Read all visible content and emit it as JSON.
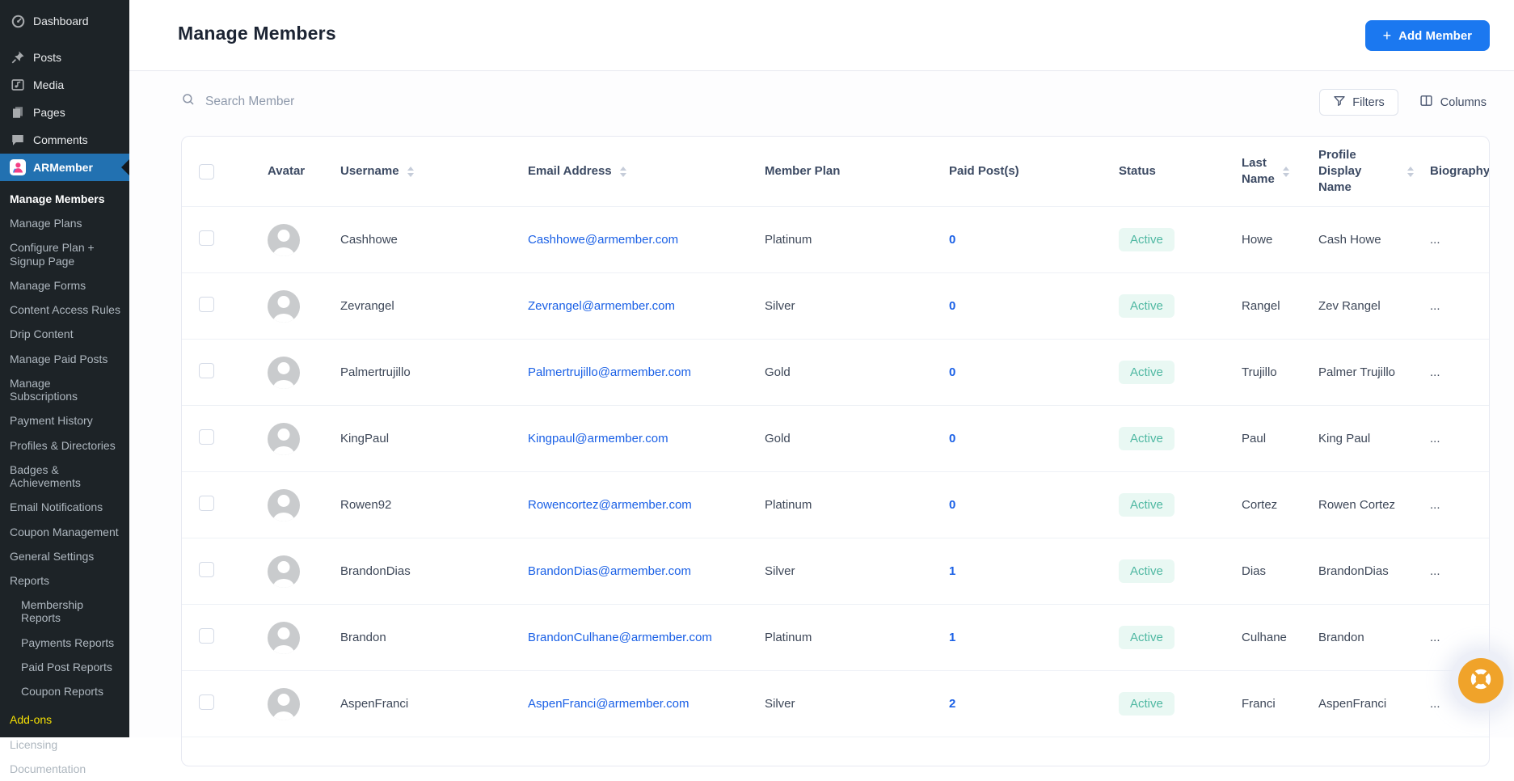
{
  "sidebar": {
    "top": [
      {
        "label": "Dashboard"
      },
      {
        "label": "Posts"
      },
      {
        "label": "Media"
      },
      {
        "label": "Pages"
      },
      {
        "label": "Comments"
      },
      {
        "label": "ARMember"
      }
    ],
    "submenu": [
      {
        "label": "Manage Members",
        "mods": "active"
      },
      {
        "label": "Manage Plans"
      },
      {
        "label": "Configure Plan +\nSignup Page"
      },
      {
        "label": "Manage Forms"
      },
      {
        "label": "Content Access Rules"
      },
      {
        "label": "Drip Content"
      },
      {
        "label": "Manage Paid Posts"
      },
      {
        "label": "Manage Subscriptions"
      },
      {
        "label": "Payment History"
      },
      {
        "label": "Profiles & Directories"
      },
      {
        "label": "Badges &\nAchievements"
      },
      {
        "label": "Email Notifications"
      },
      {
        "label": "Coupon Management"
      },
      {
        "label": "General Settings"
      },
      {
        "label": "Reports"
      },
      {
        "label": "Membership Reports",
        "mods": "indent"
      },
      {
        "label": "Payments Reports",
        "mods": "indent"
      },
      {
        "label": "Paid Post Reports",
        "mods": "indent"
      },
      {
        "label": "Coupon Reports",
        "mods": "indent"
      },
      {
        "label": "Add-ons",
        "mods": "yellow gap"
      },
      {
        "label": "Licensing"
      },
      {
        "label": "Documentation"
      }
    ]
  },
  "header": {
    "title": "Manage Members",
    "add_member": {
      "plus": "+",
      "label": "Add Member"
    }
  },
  "toolbar": {
    "search_placeholder": "Search Member",
    "filters_label": "Filters",
    "columns_label": "Columns"
  },
  "table": {
    "columns": [
      "Avatar",
      "Username",
      "Email Address",
      "Member Plan",
      "Paid Post(s)",
      "Status",
      "Last\nName",
      "Profile Display\nName",
      "Biography"
    ],
    "rows": [
      {
        "username": "Cashhowe",
        "email": "Cashhowe@armember.com",
        "plan": "Platinum",
        "paid_posts": "0",
        "status": "Active",
        "last_name": "Howe",
        "display_name": "Cash Howe",
        "biography": "..."
      },
      {
        "username": "Zevrangel",
        "email": "Zevrangel@armember.com",
        "plan": "Silver",
        "paid_posts": "0",
        "status": "Active",
        "last_name": "Rangel",
        "display_name": "Zev Rangel",
        "biography": "..."
      },
      {
        "username": "Palmertrujillo",
        "email": "Palmertrujillo@armember.com",
        "plan": "Gold",
        "paid_posts": "0",
        "status": "Active",
        "last_name": "Trujillo",
        "display_name": "Palmer Trujillo",
        "biography": "..."
      },
      {
        "username": "KingPaul",
        "email": "Kingpaul@armember.com",
        "plan": "Gold",
        "paid_posts": "0",
        "status": "Active",
        "last_name": "Paul",
        "display_name": "King Paul",
        "biography": "..."
      },
      {
        "username": "Rowen92",
        "email": "Rowencortez@armember.com",
        "plan": "Platinum",
        "paid_posts": "0",
        "status": "Active",
        "last_name": "Cortez",
        "display_name": "Rowen Cortez",
        "biography": "..."
      },
      {
        "username": "BrandonDias",
        "email": "BrandonDias@armember.com",
        "plan": "Silver",
        "paid_posts": "1",
        "status": "Active",
        "last_name": "Dias",
        "display_name": "BrandonDias",
        "biography": "..."
      },
      {
        "username": "Brandon",
        "email": "BrandonCulhane@armember.com",
        "plan": "Platinum",
        "paid_posts": "1",
        "status": "Active",
        "last_name": "Culhane",
        "display_name": "Brandon",
        "biography": "..."
      },
      {
        "username": "AspenFranci",
        "email": "AspenFranci@armember.com",
        "plan": "Silver",
        "paid_posts": "2",
        "status": "Active",
        "last_name": "Franci",
        "display_name": "AspenFranci",
        "biography": "..."
      }
    ]
  },
  "colors": {
    "sidebar_bg": "#1d2327",
    "active_menu_blue": "#2271b1",
    "accent_blue": "#1b78f0",
    "link_blue": "#1a60e6",
    "badge_bg": "#e9f8f3",
    "badge_text": "#4fb8a2",
    "addons_yellow": "#f5e003",
    "fab_orange": "#f0a32a"
  }
}
